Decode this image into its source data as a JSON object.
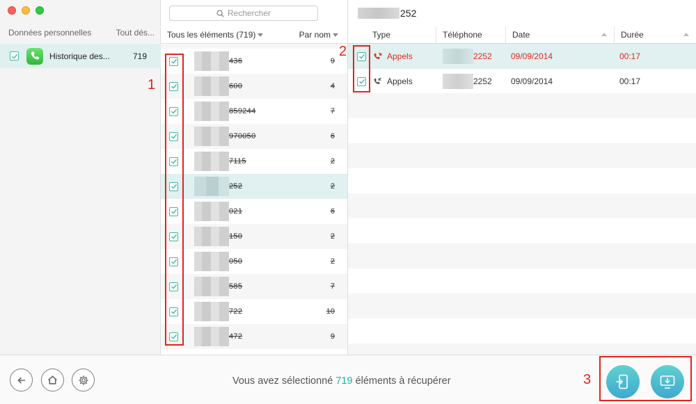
{
  "sidebar": {
    "header_left": "Données personnelles",
    "header_right": "Tout dés...",
    "item": {
      "label": "Historique des...",
      "count": "719"
    }
  },
  "middle": {
    "search_placeholder": "Rechercher",
    "all_items": "Tous les éléments (719)",
    "sort_by": "Par nom",
    "rows": [
      {
        "num": "436",
        "count": "9"
      },
      {
        "num": "600",
        "count": "4"
      },
      {
        "num": "859244",
        "count": "7"
      },
      {
        "num": "970050",
        "count": "6"
      },
      {
        "num": "7115",
        "count": "2"
      },
      {
        "num": "252",
        "count": "2"
      },
      {
        "num": "021",
        "count": "6"
      },
      {
        "num": "150",
        "count": "2"
      },
      {
        "num": "050",
        "count": "2"
      },
      {
        "num": "585",
        "count": "7"
      },
      {
        "num": "722",
        "count": "10"
      },
      {
        "num": "472",
        "count": "9"
      }
    ]
  },
  "detail": {
    "contact_suffix": "252",
    "columns": {
      "type": "Type",
      "phone": "Téléphone",
      "date": "Date",
      "duration": "Durée"
    },
    "rows": [
      {
        "type": "Appels",
        "phone_suffix": "2252",
        "date": "09/09/2014",
        "duration": "00:17",
        "color": "#e8251f"
      },
      {
        "type": "Appels",
        "phone_suffix": "2252",
        "date": "09/09/2014",
        "duration": "00:17",
        "color": "#333333"
      }
    ]
  },
  "footer": {
    "status_prefix": "Vous avez sélectionné",
    "status_count": "719",
    "status_suffix": "éléments à récupérer"
  },
  "annotations": {
    "one": "1",
    "two": "2",
    "three": "3"
  },
  "colors": {
    "accent": "#22b2a3",
    "annotation": "#e2231a"
  },
  "icons": [
    "back-icon",
    "home-icon",
    "gear-icon",
    "phone-icon",
    "search-icon",
    "missed-call-icon",
    "incoming-call-icon",
    "to-device-icon",
    "to-computer-icon"
  ]
}
